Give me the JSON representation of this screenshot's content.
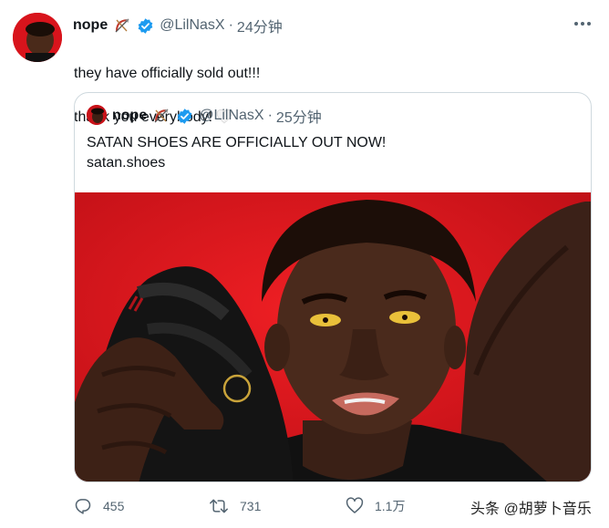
{
  "tweet": {
    "display_name": "nope",
    "handle": "@LilNasX",
    "separator": "·",
    "time": "24分钟",
    "text_line1": "they have officially sold out!!!",
    "text_line2": "thank you everybody!",
    "name_emoji_icon": "bow-and-arrow-icon",
    "text_emoji_icon": "white-heart-icon"
  },
  "quoted_tweet": {
    "display_name": "nope",
    "handle": "@LilNasX",
    "separator": "·",
    "time": "25分钟",
    "text_line1": "SATAN SHOES ARE OFFICIALLY OUT NOW!",
    "text_line2": "satan.shoes"
  },
  "actions": {
    "reply_count": "455",
    "retweet_count": "731",
    "like_count": "1.1万"
  },
  "watermark": "头条 @胡萝卜音乐",
  "colors": {
    "verified_blue": "#1d9bf0",
    "muted_text": "#536471",
    "photo_background": "#d8141c"
  }
}
